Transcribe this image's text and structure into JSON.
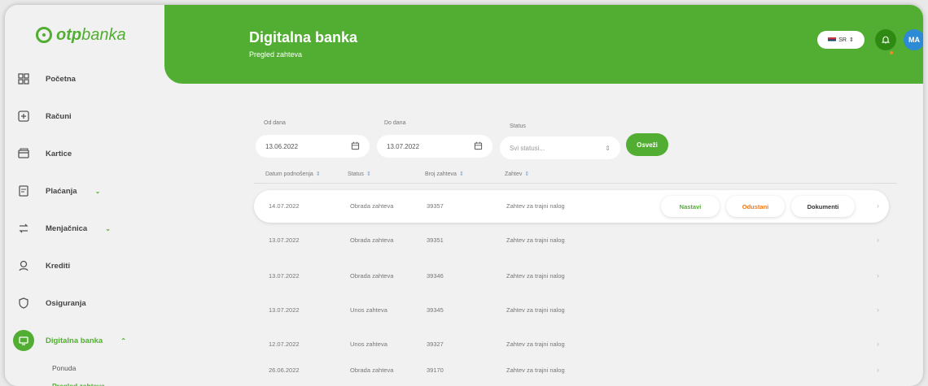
{
  "brand": {
    "logo_text_bold": "otp",
    "logo_text_light": "banka",
    "green": "#52ae32"
  },
  "sidebar": {
    "items": [
      {
        "label": "Početna",
        "icon": "dashboard-icon"
      },
      {
        "label": "Računi",
        "icon": "accounts-icon"
      },
      {
        "label": "Kartice",
        "icon": "cards-icon"
      },
      {
        "label": "Plaćanja",
        "icon": "payments-icon",
        "chevron": "⌄"
      },
      {
        "label": "Menjačnica",
        "icon": "exchange-icon",
        "chevron": "⌄"
      },
      {
        "label": "Krediti",
        "icon": "loans-icon"
      },
      {
        "label": "Osiguranja",
        "icon": "insurance-icon"
      },
      {
        "label": "Digitalna banka",
        "icon": "digital-bank-icon",
        "chevron": "⌃",
        "active": true
      }
    ],
    "sub_items": [
      {
        "label": "Ponuda"
      },
      {
        "label": "Pregled zahteva",
        "active": true
      }
    ]
  },
  "header": {
    "title": "Digitalna banka",
    "subtitle": "Pregled zahteva",
    "language": "SR",
    "avatar": "MA"
  },
  "filters": {
    "from_label": "Od dana",
    "from_value": "13.06.2022",
    "to_label": "Do dana",
    "to_value": "13.07.2022",
    "status_label": "Status",
    "status_placeholder": "Svi statusi...",
    "show_button": "Osveži"
  },
  "table": {
    "headers": [
      "Datum podnošenja",
      "Status",
      "Broj zahteva",
      "Zahtev"
    ],
    "rows": [
      {
        "date": "14.07.2022",
        "status": "Obrada zahteva",
        "number": "39357",
        "request": "Zahtev za trajni nalog"
      },
      {
        "date": "13.07.2022",
        "status": "Obrada zahteva",
        "number": "39351",
        "request": "Zahtev za trajni nalog"
      },
      {
        "date": "13.07.2022",
        "status": "Obrada zahteva",
        "number": "39346",
        "request": "Zahtev za trajni nalog"
      },
      {
        "date": "13.07.2022",
        "status": "Unos zahteva",
        "number": "39345",
        "request": "Zahtev za trajni nalog"
      },
      {
        "date": "12.07.2022",
        "status": "Unos zahteva",
        "number": "39327",
        "request": "Zahtev za trajni nalog"
      },
      {
        "date": "26.06.2022",
        "status": "Obrada zahteva",
        "number": "39170",
        "request": "Zahtev za trajni nalog"
      }
    ],
    "row_actions": {
      "continue": "Nastavi",
      "cancel": "Odustani",
      "documents": "Dokumenti"
    }
  }
}
